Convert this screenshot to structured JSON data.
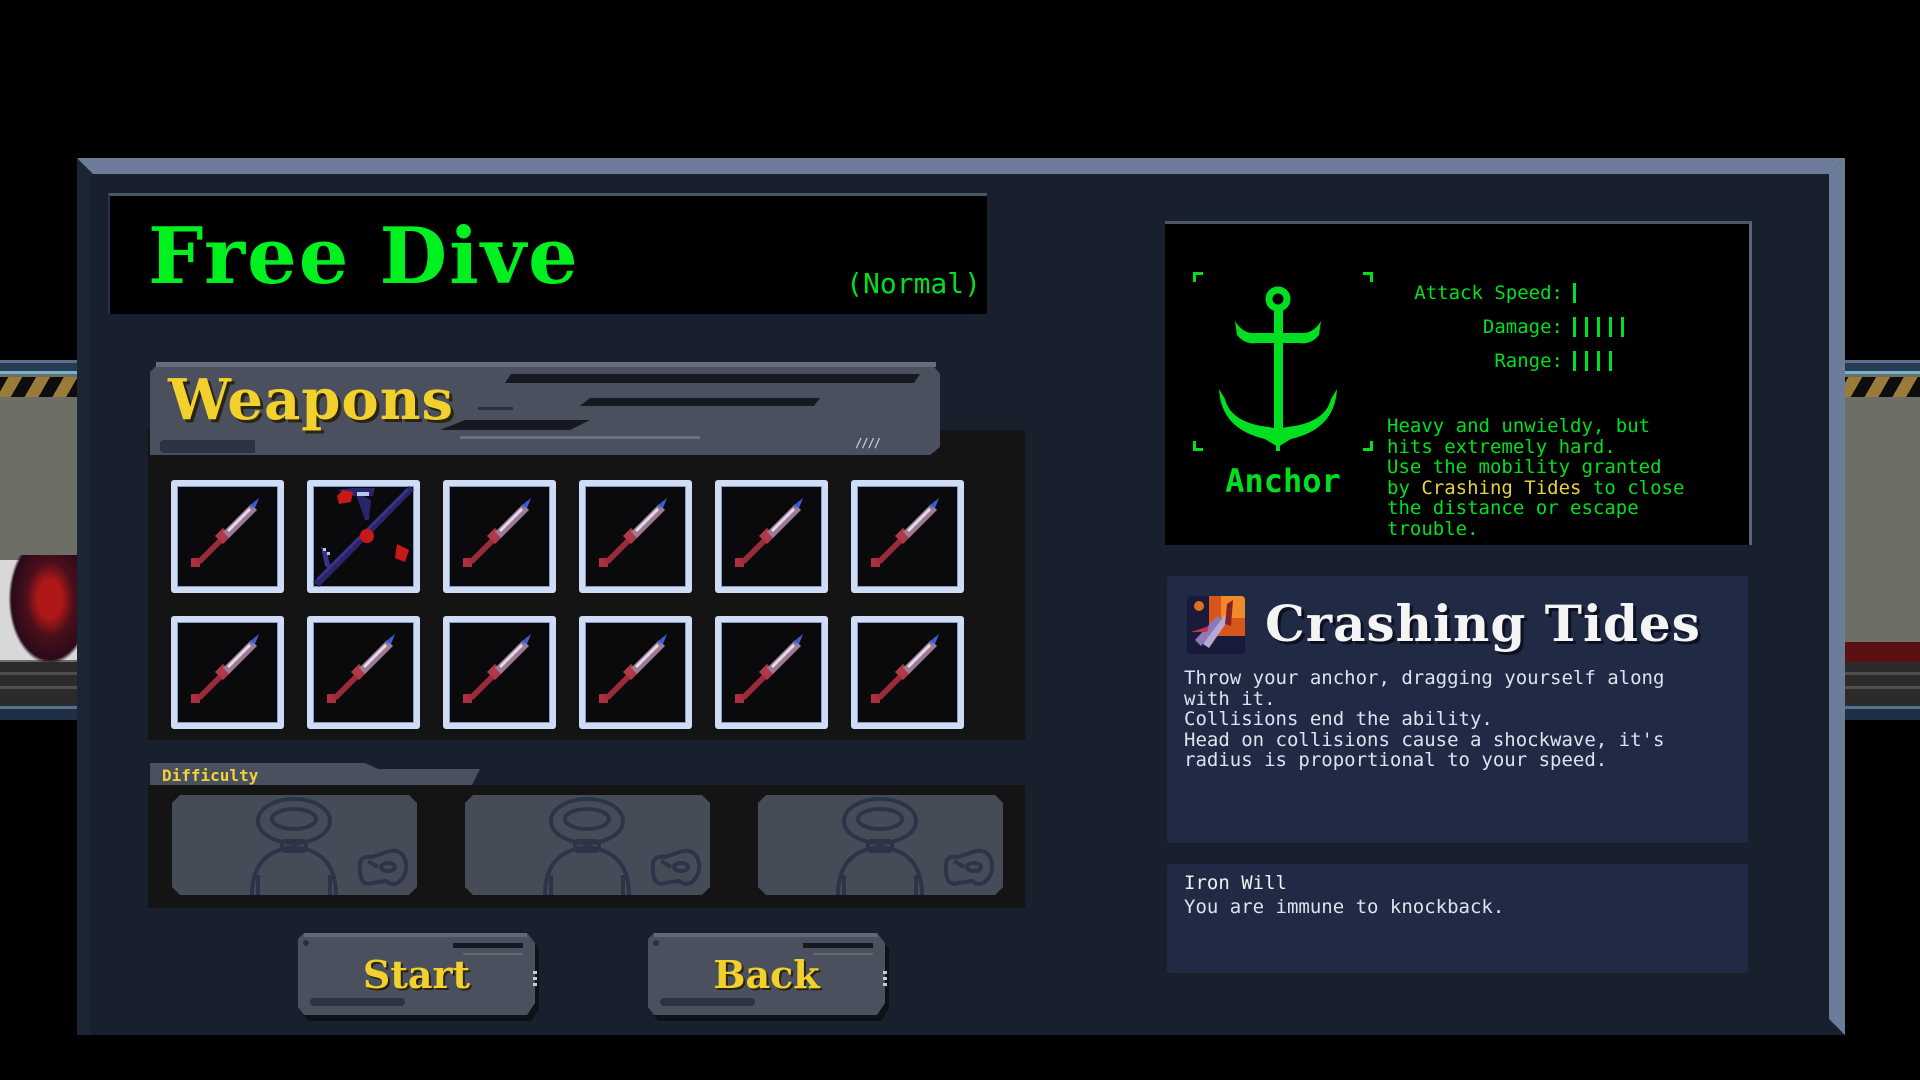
{
  "mode": {
    "title": "Free Dive",
    "difficulty_tag": "(Normal)"
  },
  "weapons": {
    "header": "Weapons",
    "header_hash": "////",
    "slots": [
      {
        "icon": "sword-icon",
        "selected": false
      },
      {
        "icon": "anchor-weapon-icon",
        "selected": true
      },
      {
        "icon": "sword-icon",
        "selected": false
      },
      {
        "icon": "sword-icon",
        "selected": false
      },
      {
        "icon": "sword-icon",
        "selected": false
      },
      {
        "icon": "sword-icon",
        "selected": false
      },
      {
        "icon": "sword-icon",
        "selected": false
      },
      {
        "icon": "sword-icon",
        "selected": false
      },
      {
        "icon": "sword-icon",
        "selected": false
      },
      {
        "icon": "sword-icon",
        "selected": false
      },
      {
        "icon": "sword-icon",
        "selected": false
      },
      {
        "icon": "sword-icon",
        "selected": false
      }
    ]
  },
  "difficulty": {
    "label": "Difficulty",
    "options": [
      {
        "icon": "diver-helmet-icon",
        "locked": true
      },
      {
        "icon": "diver-helmet-icon",
        "locked": true
      },
      {
        "icon": "diver-helmet-icon",
        "locked": true
      }
    ]
  },
  "buttons": {
    "start": "Start",
    "back": "Back"
  },
  "selected_weapon": {
    "name": "Anchor",
    "icon": "anchor-icon",
    "stats": [
      {
        "label": "Attack Speed:",
        "value": 1
      },
      {
        "label": "Damage:",
        "value": 5
      },
      {
        "label": "Range:",
        "value": 4
      }
    ],
    "description_parts": [
      {
        "text": "Heavy and unwieldy, but\nhits extremely hard.\nUse the mobility granted\nby ",
        "highlight": false
      },
      {
        "text": "Crashing Tides",
        "highlight": true
      },
      {
        "text": " to close\nthe distance or escape\ntrouble.",
        "highlight": false
      }
    ]
  },
  "ability": {
    "name": "Crashing Tides",
    "icon": "crashing-tides-icon",
    "description": "Throw your anchor, dragging yourself along\nwith it.\nCollisions end the ability.\nHead on collisions cause a shockwave, it's\nradius is proportional to your speed."
  },
  "passive": {
    "name": "Iron Will",
    "description": "You are immune to knockback."
  },
  "colors": {
    "terminal_green": "#00e020",
    "title_yellow": "#f2d12d",
    "panel_bg": "#18202e",
    "slot_border": "#cfdcf6",
    "ability_bg": "#202a45"
  }
}
